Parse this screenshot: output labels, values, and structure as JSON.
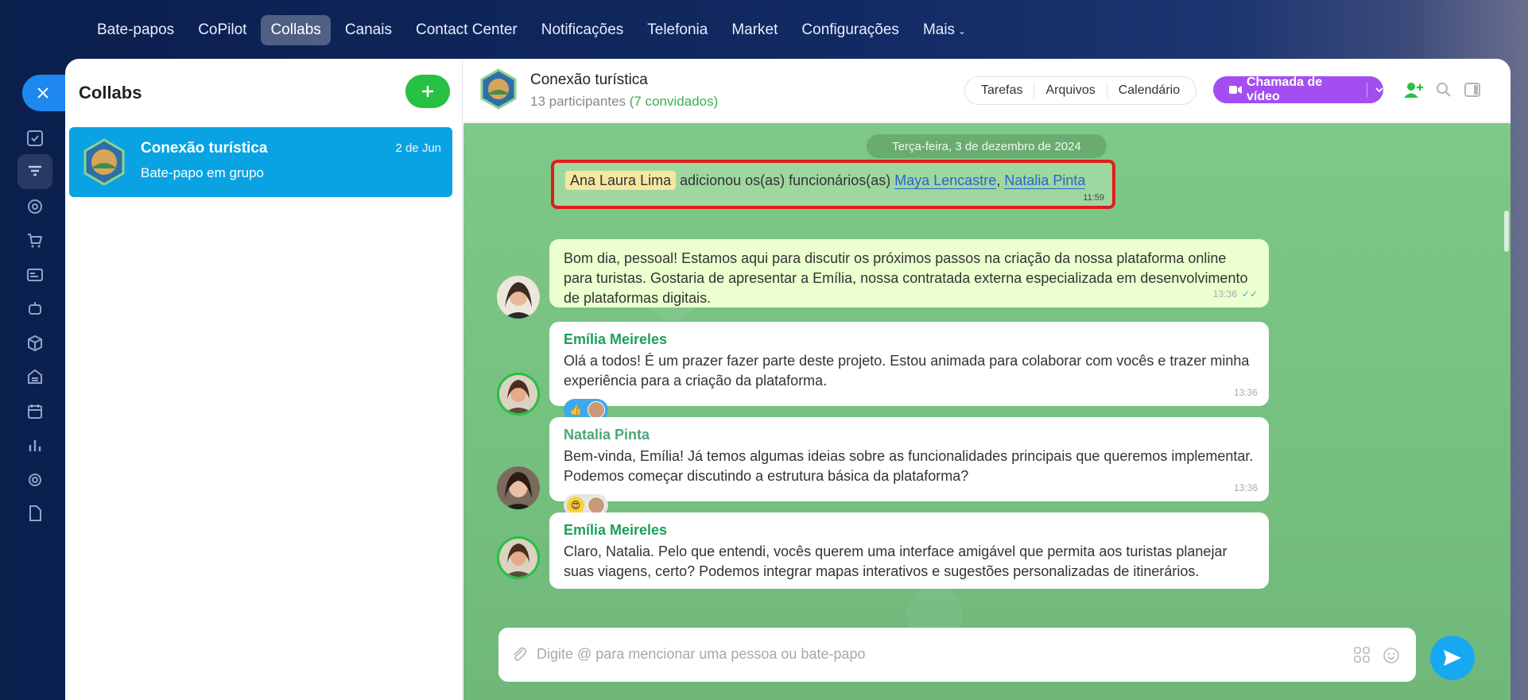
{
  "topnav": {
    "items": [
      {
        "label": "Bate-papos",
        "active": false
      },
      {
        "label": "CoPilot",
        "active": false
      },
      {
        "label": "Collabs",
        "active": true
      },
      {
        "label": "Canais",
        "active": false
      },
      {
        "label": "Contact Center",
        "active": false
      },
      {
        "label": "Notificações",
        "active": false
      },
      {
        "label": "Telefonia",
        "active": false
      },
      {
        "label": "Market",
        "active": false
      },
      {
        "label": "Configurações",
        "active": false
      },
      {
        "label": "Mais",
        "active": false
      }
    ]
  },
  "list": {
    "title": "Collabs",
    "chats": [
      {
        "name": "Conexão turística",
        "subtitle": "Bate-papo em grupo",
        "date": "2 de Jun"
      }
    ]
  },
  "chat": {
    "title": "Conexão turística",
    "participants": "13 participantes",
    "guests": "(7 convidados)",
    "tabs": [
      "Tarefas",
      "Arquivos",
      "Calendário"
    ],
    "video_button": "Chamada de vídeo",
    "date_separator": "Terça-feira, 3 de dezembro de 2024",
    "system_message": {
      "actor": "Ana Laura Lima",
      "action": " adicionou os(as) funcionários(as) ",
      "user1": "Maya Lencastre",
      "separator": ", ",
      "user2": "Natalia Pinta",
      "time": "11:59"
    },
    "messages": [
      {
        "author": "",
        "text": "Bom dia, pessoal! Estamos aqui para discutir os próximos passos na criação da nossa plataforma online para turistas. Gostaria de apresentar a Emília, nossa contratada externa especializada em desenvolvimento de plataformas digitais.",
        "time": "13:36",
        "own": true
      },
      {
        "author": "Emília Meireles",
        "text": "Olá a todos! É um prazer fazer parte deste projeto. Estou animada para colaborar com vocês e trazer minha experiência para a criação da plataforma.",
        "time": "13:36"
      },
      {
        "author": "Natalia Pinta",
        "text": "Bem-vinda, Emília! Já temos algumas ideias sobre as funcionalidades principais que queremos implementar. Podemos começar discutindo a estrutura básica da plataforma?",
        "time": "13:36"
      },
      {
        "author": "Emília Meireles",
        "text": "Claro, Natalia. Pelo que entendi, vocês querem uma interface amigável que permita aos turistas planejar suas viagens, certo? Podemos integrar mapas interativos e sugestões personalizadas de itinerários.",
        "time": ""
      }
    ],
    "input_placeholder": "Digite @ para mencionar uma pessoa ou bate-papo"
  },
  "colors": {
    "accent_blue": "#09a3e3",
    "add_green": "#26c043",
    "video_purple": "#a34ef0",
    "highlight_red": "#e01c1c"
  }
}
